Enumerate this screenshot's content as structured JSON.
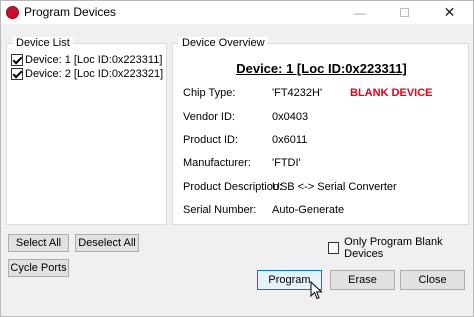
{
  "window": {
    "title": "Program Devices",
    "minimize_glyph": "—",
    "maximize_glyph": "☐",
    "close_glyph": "✕"
  },
  "device_list": {
    "label": "Device List",
    "items": [
      {
        "label": "Device: 1 [Loc ID:0x223311]",
        "checked": true
      },
      {
        "label": "Device: 2 [Loc ID:0x223321]",
        "checked": true
      }
    ]
  },
  "device_overview": {
    "label": "Device Overview",
    "heading": "Device: 1 [Loc ID:0x223311]",
    "rows": [
      {
        "label": "Chip Type:",
        "value": "'FT4232H'"
      },
      {
        "label": "Vendor ID:",
        "value": "0x0403"
      },
      {
        "label": "Product ID:",
        "value": "0x6011"
      },
      {
        "label": "Manufacturer:",
        "value": "'FTDI'"
      },
      {
        "label": "Product Description:",
        "value": "USB <-> Serial Converter"
      },
      {
        "label": "Serial Number:",
        "value": " Auto-Generate"
      }
    ],
    "status_badge": "BLANK DEVICE",
    "status_color": "#e0001b"
  },
  "buttons": {
    "select_all": "Select All",
    "deselect_all": "Deselect All",
    "cycle_ports": "Cycle Ports",
    "program": "Program",
    "erase": "Erase",
    "close": "Close"
  },
  "options": {
    "only_blank_label": "Only Program Blank Devices",
    "only_blank_checked": false
  },
  "colors": {
    "accent": "#0078d7",
    "app_icon": "#c8102e"
  }
}
